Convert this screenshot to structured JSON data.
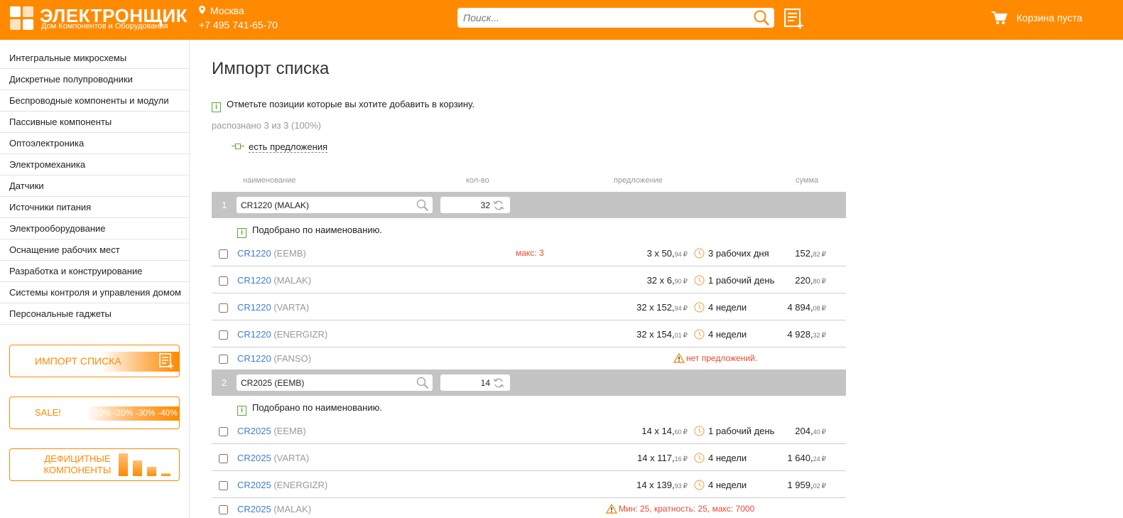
{
  "header": {
    "logo_name": "ЭЛЕКТРОНЩИК",
    "logo_tagline": "Дом Компонентов и Оборудования",
    "city": "Москва",
    "phone": "+7 495 741-65-70",
    "search_placeholder": "Поиск...",
    "cart_label": "Корзина пуста"
  },
  "sidebar": {
    "categories": [
      "Интегральные микросхемы",
      "Дискретные полупроводники",
      "Беспроводные компоненты и модули",
      "Пассивные компоненты",
      "Оптоэлектроника",
      "Электромеханика",
      "Датчики",
      "Источники питания",
      "Электрооборудование",
      "Оснащение рабочих мест",
      "Разработка и конструирование",
      "Системы контроля и управления домом",
      "Персональные гаджеты"
    ],
    "promo_import": "ИМПОРТ СПИСКА",
    "promo_sale": "SALE!",
    "promo_sale_discounts": "-10% -20% -30% -40%",
    "promo_deficit": "ДЕФИЦИТНЫЕ КОМПОНЕНТЫ"
  },
  "main": {
    "title": "Импорт списка",
    "info": "Отметьте позиции которые вы хотите добавить в корзину.",
    "recognized": "распознано 3 из 3 (100%)",
    "legend": "есть предложения",
    "columns": {
      "name": "наименование",
      "qty": "кол-во",
      "offer": "предложение",
      "sum": "сумма"
    },
    "currency": "₽",
    "groups": [
      {
        "number": "1",
        "query": "CR1220 (MALAK)",
        "qty": "32",
        "match_note": "Подобрано по наименованию.",
        "rows": [
          {
            "part": "CR1220",
            "mfr": "(EEMB)",
            "warn": "макс: 3",
            "offer_main": "3 x 50,",
            "offer_cents": "94",
            "term": "3 рабочих дня",
            "sum_main": "152,",
            "sum_cents": "82"
          },
          {
            "part": "CR1220",
            "mfr": "(MALAK)",
            "warn": "",
            "offer_main": "32 x 6,",
            "offer_cents": "90",
            "term": "1 рабочий день",
            "sum_main": "220,",
            "sum_cents": "80"
          },
          {
            "part": "CR1220",
            "mfr": "(VARTA)",
            "warn": "",
            "offer_main": "32 x 152,",
            "offer_cents": "94",
            "term": "4 недели",
            "sum_main": "4 894,",
            "sum_cents": "08"
          },
          {
            "part": "CR1220",
            "mfr": "(ENERGIZR)",
            "warn": "",
            "offer_main": "32 x 154,",
            "offer_cents": "01",
            "term": "4 недели",
            "sum_main": "4 928,",
            "sum_cents": "32"
          },
          {
            "part": "CR1220",
            "mfr": "(FANSO)",
            "no_offer": "нет предложений."
          }
        ]
      },
      {
        "number": "2",
        "query": "CR2025 (EEMB)",
        "qty": "14",
        "match_note": "Подобрано по наименованию.",
        "rows": [
          {
            "part": "CR2025",
            "mfr": "(EEMB)",
            "offer_main": "14 x 14,",
            "offer_cents": "60",
            "term": "1 рабочий день",
            "sum_main": "204,",
            "sum_cents": "40"
          },
          {
            "part": "CR2025",
            "mfr": "(VARTA)",
            "offer_main": "14 x 117,",
            "offer_cents": "16",
            "term": "4 недели",
            "sum_main": "1 640,",
            "sum_cents": "24"
          },
          {
            "part": "CR2025",
            "mfr": "(ENERGIZR)",
            "offer_main": "14 x 139,",
            "offer_cents": "93",
            "term": "4 недели",
            "sum_main": "1 959,",
            "sum_cents": "02"
          },
          {
            "part": "CR2025",
            "mfr": "(MALAK)",
            "min_warn": "Мин: 25, кратность: 25, макс: 7000"
          }
        ]
      }
    ]
  },
  "colors": {
    "brand": "#ff8a00",
    "link": "#3f7fd6",
    "warning": "#e8492f",
    "accent_green": "#5aa832",
    "group_bar": "#c4c4c4"
  },
  "icons": [
    "logo-mark",
    "location-pin-icon",
    "search-icon",
    "list-add-icon",
    "cart-icon",
    "info-icon",
    "offer-legend-icon",
    "clock-icon",
    "refresh-icon",
    "warning-icon"
  ]
}
